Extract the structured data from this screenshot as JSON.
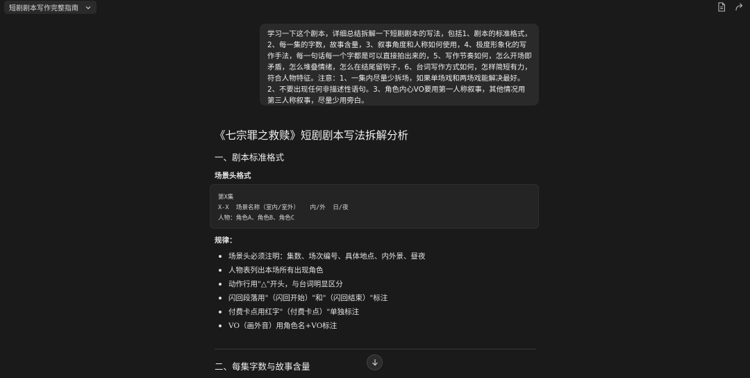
{
  "header": {
    "doc_title": "短剧剧本写作完整指南",
    "icons": [
      "chevron-down-icon",
      "document-icon",
      "share-icon"
    ]
  },
  "user_message": "学习一下这个剧本，详细总结拆解一下短剧剧本的写法，包括1、剧本的标准格式，2、每一集的字数，故事含量，3、叙事角度和人称如何使用，4、极度形象化的写作手法，每一句话每一个字都是可以直接拍出来的，5、写作节奏如何，怎么开场即矛盾，怎么堆叠情绪，怎么在结尾留钩子，6、台词写作方式如何，怎样简短有力，符合人物特征。注意：1、一集内尽量少拆场，如果单场戏和两场戏能解决最好。2、不要出现任何非描述性语句。3、角色内心VO要用第一人称叙事，其他情况用第三人称叙事，尽量少用旁白。",
  "article": {
    "title": "《七宗罪之救赎》短剧剧本写法拆解分析",
    "section1_title": "一、剧本标准格式",
    "subsection_title": "场景头格式",
    "code_lines": [
      "第X集",
      "X-X  场景名称（室内/室外）   内/外  日/夜",
      "人物：角色A、角色B、角色C"
    ],
    "rules_label": "规律：",
    "rules": [
      "场景头必须注明：集数、场次编号、具体地点、内外景、昼夜",
      "人物表列出本场所有出现角色",
      "动作行用\"△\"开头，与台词明显区分",
      "闪回段落用\"（闪回开始）\"和\"（闪回结束）\"标注",
      "付费卡点用红字\"（付费卡点）\"单独标注",
      "VO（画外音）用角色名+VO标注"
    ],
    "section2_title": "二、每集字数与故事含量"
  }
}
